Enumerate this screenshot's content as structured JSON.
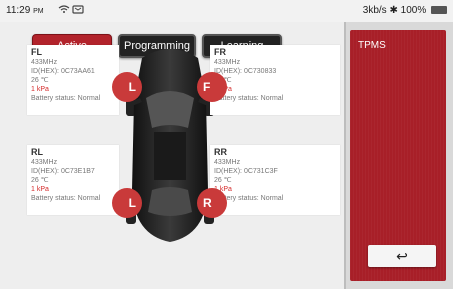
{
  "status_bar": {
    "time": "11:29",
    "ampm": "PM",
    "speed": "3kb/s",
    "battery": "100%"
  },
  "tabs": [
    {
      "label": "Active"
    },
    {
      "label": "Programming"
    },
    {
      "label": "Learning"
    }
  ],
  "sensors": {
    "fl": {
      "position": "FL",
      "frequency": "433MHz",
      "id": "ID(HEX): 0C73AA61",
      "temp": "26 ℃",
      "pressure": "1 kPa",
      "battery": "Battery status: Normal",
      "badge": "L"
    },
    "fr": {
      "position": "FR",
      "frequency": "433MHz",
      "id": "ID(HEX): 0C730833",
      "temp": "26 ℃",
      "pressure": "1 kPa",
      "battery": "Battery status: Normal",
      "badge": "F"
    },
    "rl": {
      "position": "RL",
      "frequency": "433MHz",
      "id": "ID(HEX): 0C73E1B7",
      "temp": "26 ℃",
      "pressure": "1 kPa",
      "battery": "Battery status: Normal",
      "badge": "L"
    },
    "rr": {
      "position": "RR",
      "frequency": "433MHz",
      "id": "ID(HEX): 0C731C3F",
      "temp": "26 ℃",
      "pressure": "1 kPa",
      "battery": "Battery status: Normal",
      "badge": "R"
    }
  },
  "side_panel": {
    "title": "TPMS",
    "back_icon": "↩"
  },
  "colors": {
    "accent": "#b2232b",
    "pressure_text": "#d42a2a"
  }
}
